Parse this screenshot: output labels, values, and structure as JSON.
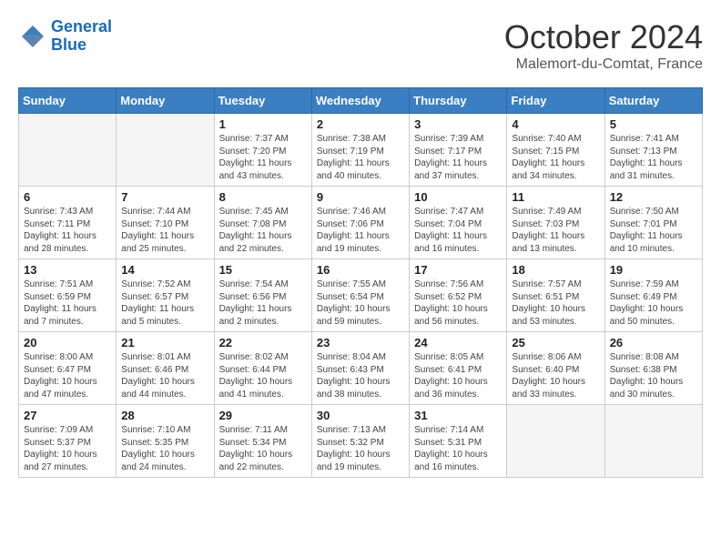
{
  "header": {
    "logo_line1": "General",
    "logo_line2": "Blue",
    "month": "October 2024",
    "location": "Malemort-du-Comtat, France"
  },
  "weekdays": [
    "Sunday",
    "Monday",
    "Tuesday",
    "Wednesday",
    "Thursday",
    "Friday",
    "Saturday"
  ],
  "weeks": [
    [
      {
        "day": "",
        "info": ""
      },
      {
        "day": "",
        "info": ""
      },
      {
        "day": "1",
        "info": "Sunrise: 7:37 AM\nSunset: 7:20 PM\nDaylight: 11 hours\nand 43 minutes."
      },
      {
        "day": "2",
        "info": "Sunrise: 7:38 AM\nSunset: 7:19 PM\nDaylight: 11 hours\nand 40 minutes."
      },
      {
        "day": "3",
        "info": "Sunrise: 7:39 AM\nSunset: 7:17 PM\nDaylight: 11 hours\nand 37 minutes."
      },
      {
        "day": "4",
        "info": "Sunrise: 7:40 AM\nSunset: 7:15 PM\nDaylight: 11 hours\nand 34 minutes."
      },
      {
        "day": "5",
        "info": "Sunrise: 7:41 AM\nSunset: 7:13 PM\nDaylight: 11 hours\nand 31 minutes."
      }
    ],
    [
      {
        "day": "6",
        "info": "Sunrise: 7:43 AM\nSunset: 7:11 PM\nDaylight: 11 hours\nand 28 minutes."
      },
      {
        "day": "7",
        "info": "Sunrise: 7:44 AM\nSunset: 7:10 PM\nDaylight: 11 hours\nand 25 minutes."
      },
      {
        "day": "8",
        "info": "Sunrise: 7:45 AM\nSunset: 7:08 PM\nDaylight: 11 hours\nand 22 minutes."
      },
      {
        "day": "9",
        "info": "Sunrise: 7:46 AM\nSunset: 7:06 PM\nDaylight: 11 hours\nand 19 minutes."
      },
      {
        "day": "10",
        "info": "Sunrise: 7:47 AM\nSunset: 7:04 PM\nDaylight: 11 hours\nand 16 minutes."
      },
      {
        "day": "11",
        "info": "Sunrise: 7:49 AM\nSunset: 7:03 PM\nDaylight: 11 hours\nand 13 minutes."
      },
      {
        "day": "12",
        "info": "Sunrise: 7:50 AM\nSunset: 7:01 PM\nDaylight: 11 hours\nand 10 minutes."
      }
    ],
    [
      {
        "day": "13",
        "info": "Sunrise: 7:51 AM\nSunset: 6:59 PM\nDaylight: 11 hours\nand 7 minutes."
      },
      {
        "day": "14",
        "info": "Sunrise: 7:52 AM\nSunset: 6:57 PM\nDaylight: 11 hours\nand 5 minutes."
      },
      {
        "day": "15",
        "info": "Sunrise: 7:54 AM\nSunset: 6:56 PM\nDaylight: 11 hours\nand 2 minutes."
      },
      {
        "day": "16",
        "info": "Sunrise: 7:55 AM\nSunset: 6:54 PM\nDaylight: 10 hours\nand 59 minutes."
      },
      {
        "day": "17",
        "info": "Sunrise: 7:56 AM\nSunset: 6:52 PM\nDaylight: 10 hours\nand 56 minutes."
      },
      {
        "day": "18",
        "info": "Sunrise: 7:57 AM\nSunset: 6:51 PM\nDaylight: 10 hours\nand 53 minutes."
      },
      {
        "day": "19",
        "info": "Sunrise: 7:59 AM\nSunset: 6:49 PM\nDaylight: 10 hours\nand 50 minutes."
      }
    ],
    [
      {
        "day": "20",
        "info": "Sunrise: 8:00 AM\nSunset: 6:47 PM\nDaylight: 10 hours\nand 47 minutes."
      },
      {
        "day": "21",
        "info": "Sunrise: 8:01 AM\nSunset: 6:46 PM\nDaylight: 10 hours\nand 44 minutes."
      },
      {
        "day": "22",
        "info": "Sunrise: 8:02 AM\nSunset: 6:44 PM\nDaylight: 10 hours\nand 41 minutes."
      },
      {
        "day": "23",
        "info": "Sunrise: 8:04 AM\nSunset: 6:43 PM\nDaylight: 10 hours\nand 38 minutes."
      },
      {
        "day": "24",
        "info": "Sunrise: 8:05 AM\nSunset: 6:41 PM\nDaylight: 10 hours\nand 36 minutes."
      },
      {
        "day": "25",
        "info": "Sunrise: 8:06 AM\nSunset: 6:40 PM\nDaylight: 10 hours\nand 33 minutes."
      },
      {
        "day": "26",
        "info": "Sunrise: 8:08 AM\nSunset: 6:38 PM\nDaylight: 10 hours\nand 30 minutes."
      }
    ],
    [
      {
        "day": "27",
        "info": "Sunrise: 7:09 AM\nSunset: 5:37 PM\nDaylight: 10 hours\nand 27 minutes."
      },
      {
        "day": "28",
        "info": "Sunrise: 7:10 AM\nSunset: 5:35 PM\nDaylight: 10 hours\nand 24 minutes."
      },
      {
        "day": "29",
        "info": "Sunrise: 7:11 AM\nSunset: 5:34 PM\nDaylight: 10 hours\nand 22 minutes."
      },
      {
        "day": "30",
        "info": "Sunrise: 7:13 AM\nSunset: 5:32 PM\nDaylight: 10 hours\nand 19 minutes."
      },
      {
        "day": "31",
        "info": "Sunrise: 7:14 AM\nSunset: 5:31 PM\nDaylight: 10 hours\nand 16 minutes."
      },
      {
        "day": "",
        "info": ""
      },
      {
        "day": "",
        "info": ""
      }
    ]
  ]
}
